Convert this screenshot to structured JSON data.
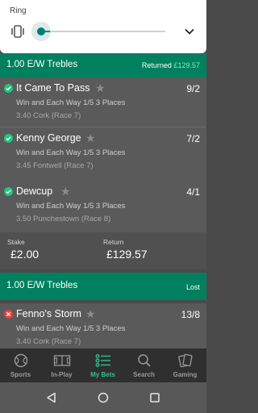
{
  "ring": {
    "title": "Ring",
    "level": 0.08
  },
  "bets": [
    {
      "title": "1.00 E/W Trebles",
      "status_label": "Returned",
      "status_amount": "£129.57",
      "selections": [
        {
          "name": "It Came To Pass",
          "odds": "9/2",
          "market": "Win and Each Way 1/5 3 Places",
          "event": "3.40 Cork (Race 7)",
          "result": "won"
        },
        {
          "name": "Kenny George",
          "odds": "7/2",
          "market": "Win and Each Way 1/5 3 Places",
          "event": "3.45 Fontwell (Race 7)",
          "result": "won"
        },
        {
          "name": "Dewcup",
          "odds": "4/1",
          "market": "Win and Each Way 1/5 3 Places",
          "event": "3.50 Punchestown (Race 8)",
          "result": "won"
        }
      ],
      "stake_label": "Stake",
      "stake_value": "£2.00",
      "return_label": "Return",
      "return_value": "£129.57"
    },
    {
      "title": "1.00 E/W Trebles",
      "status_label": "Lost",
      "selections": [
        {
          "name": "Fenno's Storm",
          "odds": "13/8",
          "market": "Win and Each Way 1/5 3 Places",
          "event": "3.40 Cork (Race 7)",
          "result": "lost"
        }
      ]
    }
  ],
  "nav": [
    {
      "label": "Sports",
      "icon": "football-icon",
      "active": false
    },
    {
      "label": "In-Play",
      "icon": "pitch-icon",
      "active": false
    },
    {
      "label": "My Bets",
      "icon": "my-bets-icon",
      "active": true
    },
    {
      "label": "Search",
      "icon": "search-icon",
      "active": false
    },
    {
      "label": "Gaming",
      "icon": "cards-icon",
      "active": false
    }
  ],
  "colors": {
    "header_green": "#00805f",
    "accent_green": "#2ec48e",
    "won_green": "#22c47e",
    "lost_red": "#e8423f"
  }
}
